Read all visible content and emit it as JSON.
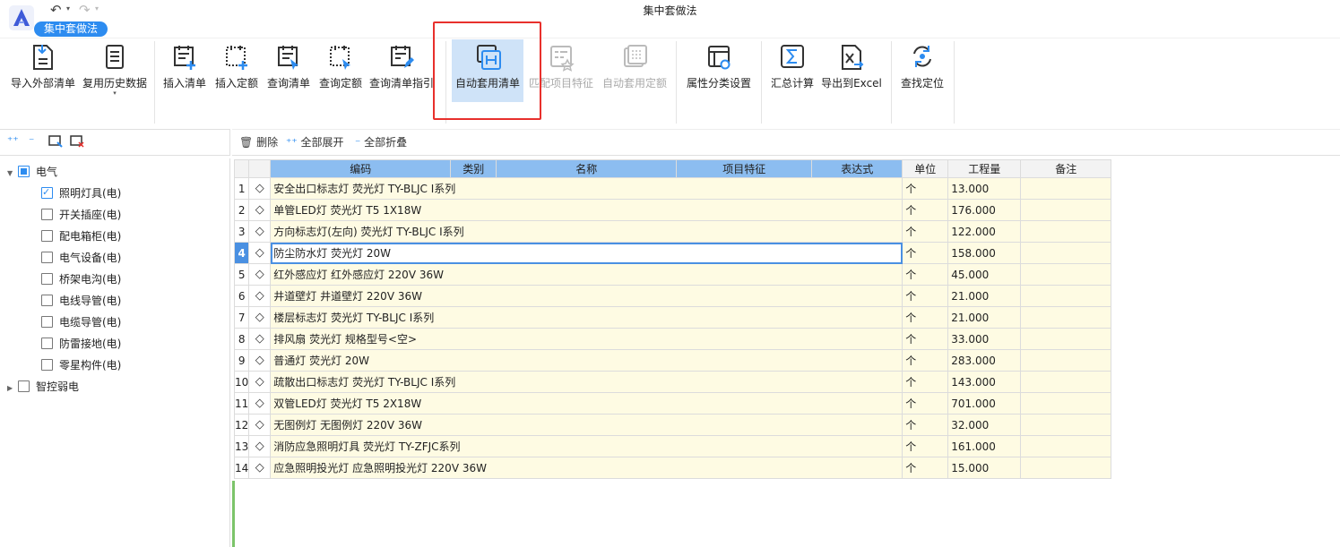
{
  "window": {
    "title": "集中套做法",
    "mode_tab": "集中套做法"
  },
  "ribbon": {
    "buttons": {
      "import_external": "导入外部清单",
      "reuse_history": "复用历史数据",
      "insert_list": "插入清单",
      "insert_quota": "插入定额",
      "query_list": "查询清单",
      "query_quota": "查询定额",
      "query_guide": "查询清单指引",
      "auto_apply_list": "自动套用清单",
      "match_features": "匹配项目特征",
      "auto_apply_quota": "自动套用定额",
      "attr_classify": "属性分类设置",
      "summary_calc": "汇总计算",
      "export_excel": "导出到Excel",
      "find_locate": "查找定位"
    }
  },
  "toolbar": {
    "delete": "删除",
    "expand_all": "全部展开",
    "collapse_all": "全部折叠"
  },
  "tree": {
    "root": "电气",
    "children": [
      "照明灯具(电)",
      "开关插座(电)",
      "配电箱柜(电)",
      "电气设备(电)",
      "桥架电沟(电)",
      "电线导管(电)",
      "电缆导管(电)",
      "防雷接地(电)",
      "零星构件(电)"
    ],
    "checked_index": 0,
    "root2": "智控弱电"
  },
  "grid": {
    "headers": {
      "code": "编码",
      "category": "类别",
      "name": "名称",
      "features": "项目特征",
      "expr": "表达式",
      "unit": "单位",
      "quantity": "工程量",
      "remark": "备注"
    },
    "selected_row": 4,
    "rows": [
      {
        "idx": "1",
        "name": "安全出口标志灯 荧光灯 TY-BLJC I系列",
        "unit": "个",
        "qty": "13.000"
      },
      {
        "idx": "2",
        "name": "单管LED灯 荧光灯 T5 1X18W",
        "unit": "个",
        "qty": "176.000"
      },
      {
        "idx": "3",
        "name": "方向标志灯(左向) 荧光灯 TY-BLJC I系列",
        "unit": "个",
        "qty": "122.000"
      },
      {
        "idx": "4",
        "name": "防尘防水灯 荧光灯 20W",
        "unit": "个",
        "qty": "158.000"
      },
      {
        "idx": "5",
        "name": "红外感应灯 红外感应灯 220V 36W",
        "unit": "个",
        "qty": "45.000"
      },
      {
        "idx": "6",
        "name": "井道壁灯 井道壁灯 220V 36W",
        "unit": "个",
        "qty": "21.000"
      },
      {
        "idx": "7",
        "name": "楼层标志灯 荧光灯 TY-BLJC I系列",
        "unit": "个",
        "qty": "21.000"
      },
      {
        "idx": "8",
        "name": "排风扇 荧光灯 规格型号<空>",
        "unit": "个",
        "qty": "33.000"
      },
      {
        "idx": "9",
        "name": "普通灯 荧光灯 20W",
        "unit": "个",
        "qty": "283.000"
      },
      {
        "idx": "10",
        "name": "疏散出口标志灯 荧光灯 TY-BLJC I系列",
        "unit": "个",
        "qty": "143.000"
      },
      {
        "idx": "11",
        "name": "双管LED灯 荧光灯 T5 2X18W",
        "unit": "个",
        "qty": "701.000"
      },
      {
        "idx": "12",
        "name": "无图例灯 无图例灯 220V 36W",
        "unit": "个",
        "qty": "32.000"
      },
      {
        "idx": "13",
        "name": "消防应急照明灯具 荧光灯 TY-ZFJC系列",
        "unit": "个",
        "qty": "161.000"
      },
      {
        "idx": "14",
        "name": "应急照明投光灯 应急照明投光灯 220V 36W",
        "unit": "个",
        "qty": "15.000"
      }
    ]
  },
  "colors": {
    "accent": "#2d8cf0",
    "header_blue": "#8cbdf0",
    "highlight": "#e8302c",
    "row_yellow": "#fefbe3"
  }
}
